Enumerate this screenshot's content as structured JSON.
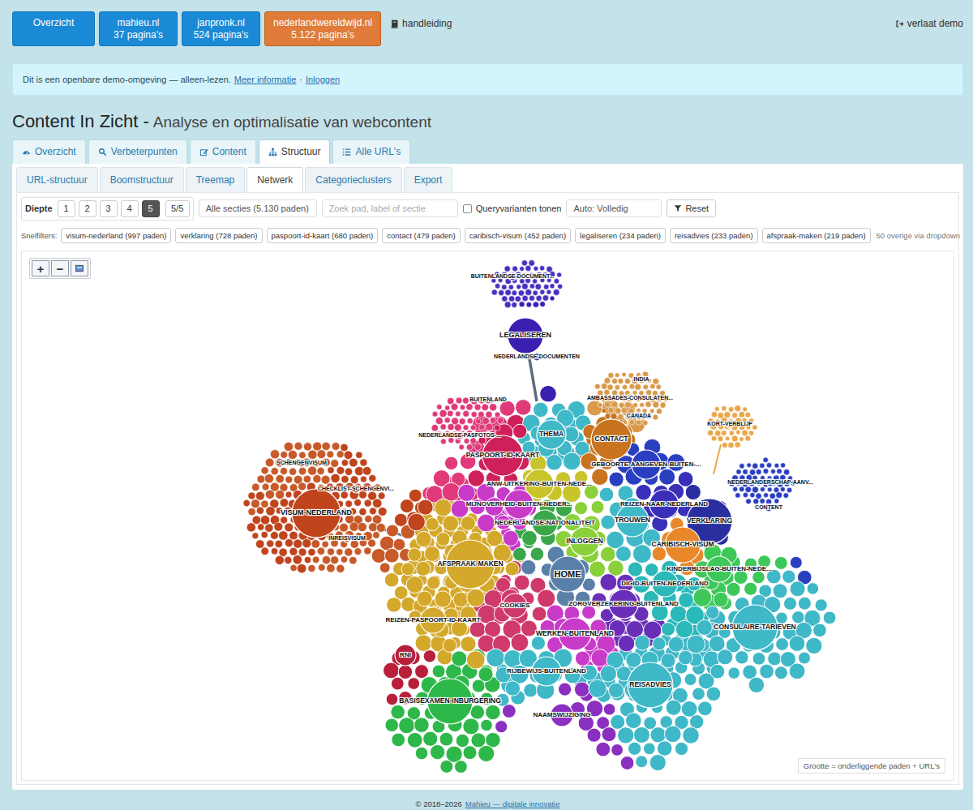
{
  "site_buttons": [
    {
      "label": "Overzicht",
      "selected": false
    },
    {
      "label": "mahieu.nl",
      "count": "37 pagina's",
      "selected": false
    },
    {
      "label": "janpronk.nl",
      "count": "524 pagina's",
      "selected": false
    },
    {
      "label": "nederlandwereldwijd.nl",
      "count": "5.122 pagina's",
      "selected": true
    }
  ],
  "manual_link": "handleiding",
  "exit_link": "verlaat demo",
  "alert": {
    "text": "Dit is een openbare demo-omgeving — alleen-lezen.",
    "links": [
      "Meer informatie",
      "Inloggen"
    ],
    "separator": "·"
  },
  "title": {
    "main": "Content In Zicht -",
    "subtitle": "Analyse en optimalisatie van webcontent"
  },
  "tabs": [
    {
      "label": "Overzicht",
      "selected": false
    },
    {
      "label": "Verbeterpunten",
      "selected": false
    },
    {
      "label": "Content",
      "selected": false
    },
    {
      "label": "Structuur",
      "selected": true
    },
    {
      "label": "Alle URL's",
      "selected": false
    }
  ],
  "subtabs": [
    {
      "label": "URL-structuur",
      "selected": false
    },
    {
      "label": "Boomstructuur",
      "selected": false
    },
    {
      "label": "Treemap",
      "selected": false
    },
    {
      "label": "Netwerk",
      "selected": true
    },
    {
      "label": "Categorieclusters",
      "selected": false
    },
    {
      "label": "Export",
      "selected": false
    }
  ],
  "controls": {
    "depth_label": "Diepte",
    "depth_options": [
      {
        "label": "1",
        "selected": false
      },
      {
        "label": "2",
        "selected": false
      },
      {
        "label": "3",
        "selected": false
      },
      {
        "label": "4",
        "selected": false
      },
      {
        "label": "5",
        "selected": true
      },
      {
        "label": "5/5",
        "selected": false
      }
    ],
    "section_select": "Alle secties (5.130 paden)",
    "search_placeholder": "Zoek pad, label of sectie",
    "query_variants": {
      "label": "Queryvarianten tonen",
      "checked": false
    },
    "mode_select": "Auto: Volledig",
    "reset": "Reset"
  },
  "quick_filters": {
    "label": "Snelfilters:",
    "chips": [
      "visum-nederland (997 paden)",
      "verklaring (728 paden)",
      "paspoort-id-kaart (680 paden)",
      "contact (479 paden)",
      "caribisch-visum (452 paden)",
      "legaliseren (234 paden)",
      "reisadvies (233 paden)",
      "afspraak-maken (219 paden)"
    ],
    "more": "50 overige via dropdown"
  },
  "network": {
    "zoom": {
      "in": "+",
      "out": "−"
    },
    "nodes": [
      {
        "label": "BUITENLANDSE-DOCUMENT...",
        "color": "#4a2fc0"
      },
      {
        "label": "LEGALISEREN",
        "color": "#3a1fb0"
      },
      {
        "label": "NEDERLANDSE-DOCUMENTEN",
        "color": "#3a1fb0"
      },
      {
        "label": "INDIA",
        "color": "#d99a4a"
      },
      {
        "label": "AMBASSADES-CONSULATEN...",
        "color": "#d99a4a"
      },
      {
        "label": "CANADA",
        "color": "#d99a4a"
      },
      {
        "label": "BUITENLAND",
        "color": "#e03a7a"
      },
      {
        "label": "THEMA",
        "color": "#3fb8c8"
      },
      {
        "label": "CONTACT",
        "color": "#c8741e"
      },
      {
        "label": "KORT-VERBLIJF",
        "color": "#e8a84a"
      },
      {
        "label": "NEDERLANDSE-PASFOTOS-...",
        "color": "#e03a7a"
      },
      {
        "label": "PASPOORT-ID-KAART",
        "color": "#d0205a"
      },
      {
        "label": "GEBOORTE-AANGEVEN-BUITEN-...",
        "color": "#2a3fc0"
      },
      {
        "label": "SCHENGENVISUM",
        "color": "#c85a2a"
      },
      {
        "label": "CHECKLIST-SCHENGENVI...",
        "color": "#c0441c"
      },
      {
        "label": "NEDERLANDERSCHAP-AANV...",
        "color": "#2a3fc0"
      },
      {
        "label": "ANW-UITKERING-BUITEN-NEDE...",
        "color": "#c8c42a"
      },
      {
        "label": "CONTENT",
        "color": "#2a3fc0"
      },
      {
        "label": "VISUM-NEDERLAND",
        "color": "#c0441c"
      },
      {
        "label": "MIJNOVERHEID-BUITEN-NEDER...",
        "color": "#c83ac8"
      },
      {
        "label": "REIZEN-NAAR-NEDERLAND",
        "color": "#3a2fb8"
      },
      {
        "label": "NEDERLANDSE-NATIONALITEIT",
        "color": "#3aa84a"
      },
      {
        "label": "TROUWEN",
        "color": "#3fb8c8"
      },
      {
        "label": "VERKLARING",
        "color": "#2a2fa0"
      },
      {
        "label": "INREISVISUM",
        "color": "#c85a2a"
      },
      {
        "label": "INLOGGEN",
        "color": "#8ad03a"
      },
      {
        "label": "CARIBISCH-VISUM",
        "color": "#e8882a"
      },
      {
        "label": "AFSPRAAK-MAKEN",
        "color": "#d4a82a"
      },
      {
        "label": "KINDERBIJSLAG-BUITEN-NEDE...",
        "color": "#3fc85a"
      },
      {
        "label": "HOME",
        "color": "#5a7fa8"
      },
      {
        "label": "DIGID-BUITEN-NEDERLAND",
        "color": "#2ab8b8"
      },
      {
        "label": "COOKIES",
        "color": "#d03a6a"
      },
      {
        "label": "ZORGVERZEKERING-BUITENLAND",
        "color": "#6a2fb8"
      },
      {
        "label": "REIZEN-PASPOORT-ID-KAART",
        "color": "#d4a82a"
      },
      {
        "label": "CONSULAIRE-TARIEVEN",
        "color": "#3fb8c8"
      },
      {
        "label": "WERKEN-BUITENLAND",
        "color": "#c83ac8"
      },
      {
        "label": "RNI",
        "color": "#b8203a"
      },
      {
        "label": "RIJBEWIJS-BUITENLAND",
        "color": "#3fb8c8"
      },
      {
        "label": "REISADVIES",
        "color": "#3fb8c8"
      },
      {
        "label": "BASISEXAMEN-INBURGERING",
        "color": "#2eb84a"
      },
      {
        "label": "NAAMSWIJZIGING",
        "color": "#8a2fc0"
      }
    ],
    "legend": "Grootte = onderliggende paden + URL's"
  },
  "footer": {
    "text": "© 2018–2026",
    "link": "Mahieu — digitale innovatie"
  }
}
